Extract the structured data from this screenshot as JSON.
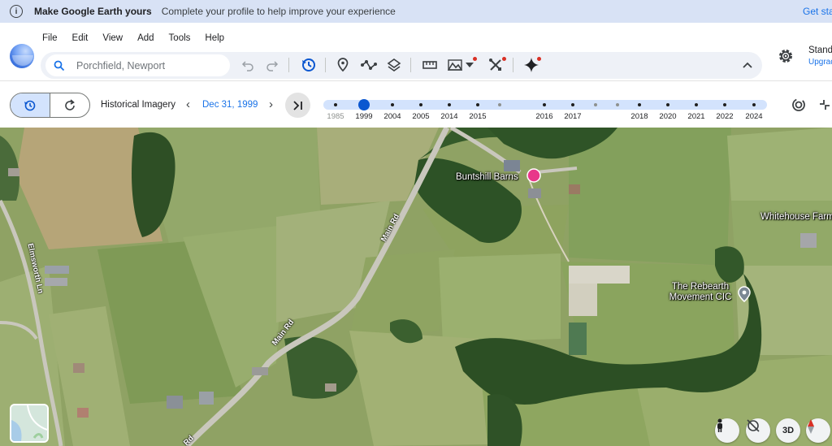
{
  "banner": {
    "info_icon": "info-icon",
    "title": "Make Google Earth yours",
    "message": "Complete your profile to help improve your experience",
    "cta": "Get sta"
  },
  "menu": [
    "File",
    "Edit",
    "View",
    "Add",
    "Tools",
    "Help"
  ],
  "search": {
    "placeholder": "Porchfield, Newport"
  },
  "toolbar_icons": [
    "undo-icon",
    "redo-icon",
    "historical-imagery-icon",
    "placemark-icon",
    "path-icon",
    "layers-icon",
    "measure-icon",
    "map-style-icon",
    "tools-icon",
    "gemini-icon",
    "collapse-icon"
  ],
  "account": {
    "title": "Stand",
    "subtitle": "Upgrad"
  },
  "historical": {
    "label": "Historical Imagery",
    "date": "Dec 31, 1999",
    "years": [
      {
        "label": "1985",
        "dim": true
      },
      {
        "label": "1999",
        "selected": true
      },
      {
        "label": "2004"
      },
      {
        "label": "2005"
      },
      {
        "label": "2014"
      },
      {
        "label": "2015"
      },
      {
        "label": "2016"
      },
      {
        "label": "2017"
      },
      {
        "label": "2018"
      },
      {
        "label": "2020"
      },
      {
        "label": "2021"
      },
      {
        "label": "2022"
      },
      {
        "label": "2024"
      }
    ]
  },
  "map": {
    "places": [
      "Buntshill Barns",
      "Whitehouse Farm",
      "The Rebearth Movement CIC"
    ],
    "roads": [
      "Main Rd",
      "Main Rd",
      "Elmsworth Ln",
      "Rd"
    ],
    "controls": {
      "three_d": "3D"
    }
  },
  "colors": {
    "accent": "#1a73e8",
    "selected_tick": "#0b57d0",
    "banner_bg": "#d8e2f5",
    "pin_pink": "#e8388a"
  }
}
